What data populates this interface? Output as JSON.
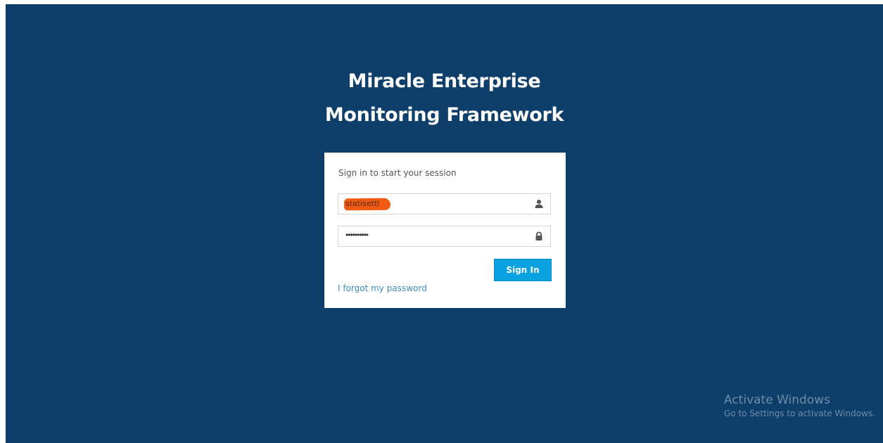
{
  "app": {
    "title_line1": "Miracle Enterprise",
    "title_line2": "Monitoring Framework"
  },
  "login": {
    "subtitle": "Sign in to start your session",
    "username_value": "statisetti",
    "password_mask": "••••••••••",
    "user_icon": "user-icon",
    "lock_icon": "lock-icon",
    "signin_label": "Sign In",
    "forgot_label": "I forgot my password"
  },
  "watermark": {
    "title": "Activate Windows",
    "subtitle": "Go to Settings to activate Windows."
  },
  "colors": {
    "background": "#0e3e6a",
    "button": "#0aa1e0",
    "link": "#3c8dbc",
    "redaction": "#f05a12"
  }
}
